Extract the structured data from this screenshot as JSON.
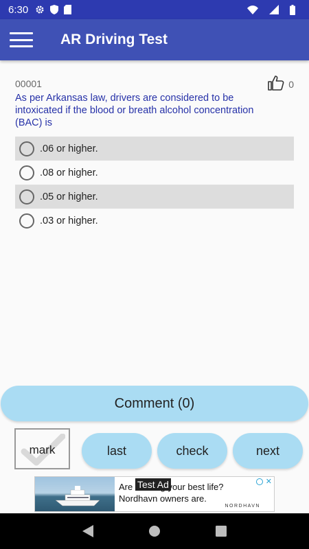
{
  "status_bar": {
    "time": "6:30"
  },
  "app_bar": {
    "title": "AR Driving Test"
  },
  "question": {
    "number": "00001",
    "likes": "0",
    "text": "As per Arkansas law, drivers are considered to be intoxicated if the blood or breath alcohol concentration (BAC) is",
    "options": [
      {
        "label": ".06 or higher.",
        "selected": false
      },
      {
        "label": ".08 or higher.",
        "selected": false
      },
      {
        "label": ".05 or higher.",
        "selected": false
      },
      {
        "label": ".03 or higher.",
        "selected": false
      }
    ]
  },
  "actions": {
    "comment_label": "Comment (0)",
    "mark_label": "mark",
    "last_label": "last",
    "check_label": "check",
    "next_label": "next"
  },
  "ad": {
    "badge": "Test Ad",
    "text_line1": "Are ... living your best life?",
    "text_line2": "Nordhavn owners are.",
    "brand": "NORDHAVN"
  },
  "colors": {
    "primary": "#3f51b5",
    "status_bar": "#2d3ab0",
    "question_text": "#2631a8",
    "button_fill": "#aadcf3",
    "option_shade": "#dddddd"
  },
  "icons": {
    "menu": "hamburger-menu-icon",
    "like": "thumbs-up-icon",
    "settings": "gear-icon",
    "shield": "shield-icon",
    "sim": "sim-card-icon",
    "wifi": "wifi-icon",
    "signal": "signal-icon",
    "battery": "battery-icon",
    "nav_back": "back-triangle-icon",
    "nav_home": "home-circle-icon",
    "nav_recents": "recents-square-icon"
  }
}
